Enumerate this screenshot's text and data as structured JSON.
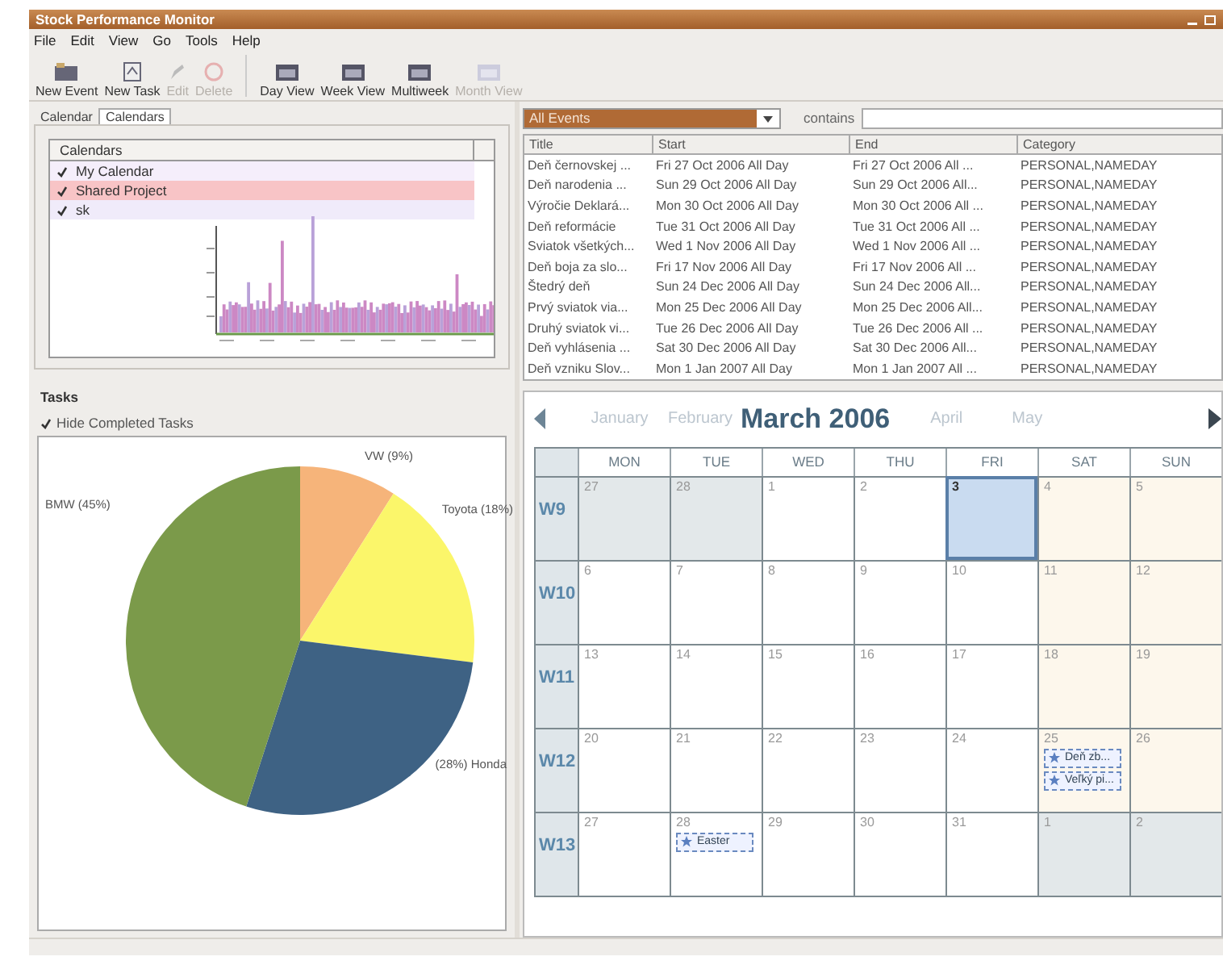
{
  "window": {
    "title": "Stock Performance Monitor"
  },
  "menu": [
    "File",
    "Edit",
    "View",
    "Go",
    "Tools",
    "Help"
  ],
  "toolbar": [
    {
      "label": "New Event",
      "kind": "event",
      "disabled": false
    },
    {
      "label": "New Task",
      "kind": "task",
      "disabled": false
    },
    {
      "label": "Edit",
      "kind": "edit",
      "disabled": true
    },
    {
      "label": "Delete",
      "kind": "delete",
      "disabled": true
    },
    {
      "label": "Day View",
      "kind": "view",
      "disabled": false
    },
    {
      "label": "Week View",
      "kind": "view",
      "disabled": false
    },
    {
      "label": "Multiweek",
      "kind": "view",
      "disabled": false
    },
    {
      "label": "Month View",
      "kind": "view",
      "disabled": true
    }
  ],
  "left_tabs": [
    {
      "label": "Calendar",
      "selected": false
    },
    {
      "label": "Calendars",
      "selected": true
    }
  ],
  "calendars": {
    "header": "Calendars",
    "items": [
      {
        "name": "My Calendar",
        "checked": true,
        "color": "#f5eefb"
      },
      {
        "name": "Shared Project",
        "checked": true,
        "color": "#f8c4c6"
      },
      {
        "name": "sk",
        "checked": true,
        "color": "#f0ebfa"
      }
    ]
  },
  "tasks": {
    "title": "Tasks",
    "hide_completed": {
      "label": "Hide Completed Tasks",
      "checked": true
    },
    "chart_data": {
      "type": "pie",
      "categories": [
        "VW (9%)",
        "Toyota (18%)",
        "(28%) Honda",
        "BMW (45%)"
      ],
      "values": [
        9,
        18,
        28,
        45
      ],
      "colors": [
        "#f6b47a",
        "#fbf66a",
        "#3e6284",
        "#7b9a4a"
      ]
    }
  },
  "filter": {
    "selection": "All Events",
    "contains_label": "contains"
  },
  "events_table": {
    "columns": [
      "Title",
      "Start",
      "End",
      "Category"
    ],
    "rows": [
      [
        "Deň černovskej ...",
        "Fri 27 Oct 2006 All Day",
        "Fri 27 Oct 2006 All ...",
        "PERSONAL,NAMEDAY"
      ],
      [
        "Deň narodenia ...",
        "Sun 29 Oct 2006 All Day",
        "Sun 29 Oct 2006 All...",
        "PERSONAL,NAMEDAY"
      ],
      [
        "Výročie Deklará...",
        "Mon 30 Oct 2006 All Day",
        "Mon 30 Oct 2006 All ...",
        "PERSONAL,NAMEDAY"
      ],
      [
        "Deň reformácie",
        "Tue 31 Oct 2006 All Day",
        "Tue 31 Oct 2006 All ...",
        "PERSONAL,NAMEDAY"
      ],
      [
        "Sviatok všetkých...",
        "Wed 1 Nov 2006 All Day",
        "Wed 1 Nov 2006 All ...",
        "PERSONAL,NAMEDAY"
      ],
      [
        "Deň boja za slo...",
        "Fri 17 Nov 2006 All Day",
        "Fri 17 Nov 2006 All ...",
        "PERSONAL,NAMEDAY"
      ],
      [
        "Štedrý deň",
        "Sun 24 Dec 2006 All Day",
        "Sun 24 Dec 2006 All...",
        "PERSONAL,NAMEDAY"
      ],
      [
        "Prvý sviatok via...",
        "Mon 25 Dec 2006 All Day",
        "Mon 25 Dec 2006 All...",
        "PERSONAL,NAMEDAY"
      ],
      [
        "Druhý sviatok vi...",
        "Tue 26 Dec 2006 All Day",
        "Tue 26 Dec 2006 All ...",
        "PERSONAL,NAMEDAY"
      ],
      [
        "Deň vyhlásenia ...",
        "Sat 30 Dec 2006 All Day",
        "Sat 30 Dec 2006 All...",
        "PERSONAL,NAMEDAY"
      ],
      [
        "Deň vzniku Slov...",
        "Mon 1 Jan 2007 All Day",
        "Mon 1 Jan 2007 All ...",
        "PERSONAL,NAMEDAY"
      ]
    ]
  },
  "month_view": {
    "months": [
      {
        "label": "January",
        "current": false
      },
      {
        "label": "February",
        "current": false
      },
      {
        "label": "March 2006",
        "current": true
      },
      {
        "label": "April",
        "current": false
      },
      {
        "label": "May",
        "current": false
      }
    ],
    "weekdays": [
      "MON",
      "TUE",
      "WED",
      "THU",
      "FRI",
      "SAT",
      "SUN"
    ],
    "weeks": [
      {
        "label": "W9",
        "days": [
          {
            "day": "27",
            "in_month": false,
            "selected": false
          },
          {
            "day": "28",
            "in_month": false,
            "selected": false
          },
          {
            "day": "1",
            "in_month": true,
            "selected": false
          },
          {
            "day": "2",
            "in_month": true,
            "selected": false
          },
          {
            "day": "3",
            "in_month": true,
            "selected": true
          },
          {
            "day": "4",
            "in_month": true,
            "selected": false
          },
          {
            "day": "5",
            "in_month": true,
            "selected": false
          }
        ]
      },
      {
        "label": "W10",
        "days": [
          {
            "day": "6",
            "in_month": true,
            "selected": false
          },
          {
            "day": "7",
            "in_month": true,
            "selected": false
          },
          {
            "day": "8",
            "in_month": true,
            "selected": false
          },
          {
            "day": "9",
            "in_month": true,
            "selected": false
          },
          {
            "day": "10",
            "in_month": true,
            "selected": false
          },
          {
            "day": "11",
            "in_month": true,
            "selected": false
          },
          {
            "day": "12",
            "in_month": true,
            "selected": false
          }
        ]
      },
      {
        "label": "W11",
        "days": [
          {
            "day": "13",
            "in_month": true,
            "selected": false
          },
          {
            "day": "14",
            "in_month": true,
            "selected": false
          },
          {
            "day": "15",
            "in_month": true,
            "selected": false
          },
          {
            "day": "16",
            "in_month": true,
            "selected": false
          },
          {
            "day": "17",
            "in_month": true,
            "selected": false
          },
          {
            "day": "18",
            "in_month": true,
            "selected": false
          },
          {
            "day": "19",
            "in_month": true,
            "selected": false
          }
        ]
      },
      {
        "label": "W12",
        "days": [
          {
            "day": "20",
            "in_month": true,
            "selected": false
          },
          {
            "day": "21",
            "in_month": true,
            "selected": false
          },
          {
            "day": "22",
            "in_month": true,
            "selected": false
          },
          {
            "day": "23",
            "in_month": true,
            "selected": false
          },
          {
            "day": "24",
            "in_month": true,
            "selected": false
          },
          {
            "day": "25",
            "in_month": true,
            "selected": false,
            "events": [
              "Deň zb...",
              "Veľký pi..."
            ]
          },
          {
            "day": "26",
            "in_month": true,
            "selected": false
          }
        ]
      },
      {
        "label": "W13",
        "days": [
          {
            "day": "27",
            "in_month": true,
            "selected": false
          },
          {
            "day": "28",
            "in_month": true,
            "selected": false,
            "events": [
              "Easter"
            ]
          },
          {
            "day": "29",
            "in_month": true,
            "selected": false
          },
          {
            "day": "30",
            "in_month": true,
            "selected": false
          },
          {
            "day": "31",
            "in_month": true,
            "selected": false
          },
          {
            "day": "1",
            "in_month": false,
            "selected": false
          },
          {
            "day": "2",
            "in_month": false,
            "selected": false
          }
        ]
      }
    ]
  }
}
